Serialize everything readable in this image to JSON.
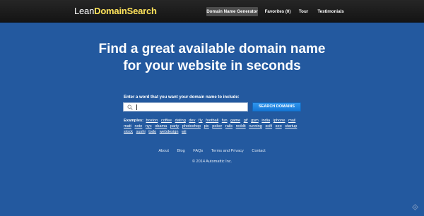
{
  "logo": {
    "part1": "Lean",
    "part2": "DomainSearch"
  },
  "nav": {
    "items": [
      {
        "label": "Domain Name Generator",
        "active": true
      },
      {
        "label": "Favorites (0)",
        "active": false
      },
      {
        "label": "Tour",
        "active": false
      },
      {
        "label": "Testimonials",
        "active": false
      }
    ]
  },
  "hero": {
    "line1": "Find a great available domain name",
    "line2": "for your website in seconds"
  },
  "search": {
    "label": "Enter a word that you want your domain name to include:",
    "value": "",
    "button": "SEARCH DOMAINS"
  },
  "examples": {
    "label": "Examples:",
    "words": [
      "boston",
      "coffee",
      "dating",
      "dev",
      "fly",
      "football",
      "fun",
      "game",
      "gif",
      "gym",
      "india",
      "iphone",
      "mail",
      "matt",
      "note",
      "nyc",
      "obama",
      "party",
      "photoshop",
      "pic",
      "poker",
      "rails",
      "reddit",
      "running",
      "scifi",
      "seo",
      "startup",
      "stock",
      "sushi",
      "todo",
      "webdesign",
      "wii"
    ]
  },
  "footer": {
    "links": [
      "About",
      "Blog",
      "FAQs",
      "Terms and Privacy",
      "Contact"
    ],
    "copyright": "© 2014 Automattic Inc."
  },
  "colors": {
    "background": "#23599f",
    "logo_accent": "#ffe35b",
    "button": "#1a7fdc"
  },
  "icons": {
    "search": "magnifier-icon",
    "corner": "diamond-nav-icon"
  }
}
